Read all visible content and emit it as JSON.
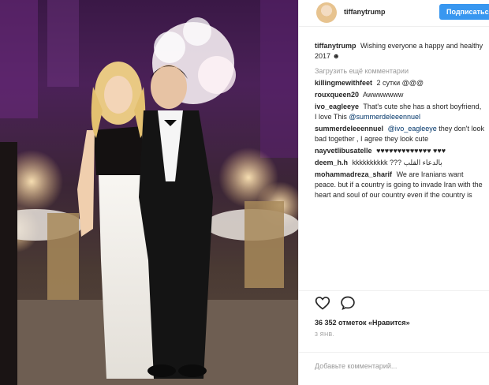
{
  "post": {
    "username": "tiffanytrump",
    "follow_label": "Подписаться",
    "caption_user": "tiffanytrump",
    "caption_text": "Wishing everyone a happy and healthy 2017 ☻",
    "likes": "36 352 отметок «Нравится»",
    "posted": "3 ЯНВ.",
    "add_comment_placeholder": "Добавьте комментарий..."
  },
  "comments": [
    {
      "user": "",
      "text": "Загрузить ещё комментарии"
    },
    {
      "user": "killingmewithfeet",
      "text": "2 сутки @@@"
    },
    {
      "user": "rouxqueen20",
      "text": "Awwwwwww"
    },
    {
      "user": "ivo_eagleeye",
      "text": "That's cute she has a short boyfriend, I love This",
      "mention": "@summerdeleeennuel"
    },
    {
      "user": "summerdeleeennuel",
      "text": "they don't look bad together , I agree they look cute",
      "mention": "@ivo_eagleeye"
    },
    {
      "user": "nayvetlibusatelle",
      "text": "♥♥♥♥♥♥♥♥♥♥♥♥♥ ♥♥♥"
    },
    {
      "user": "deem_h.h",
      "text": "kkkkkkkkkk ??? بالدعاء القلب"
    },
    {
      "user": "mohammadreza_sharif",
      "text": "We are Iranians want peace. but if a country is going to invade Iran with the heart and soul of our country even if the country is America. You will never see us"
    }
  ],
  "icons": {
    "like": "heart-outline-icon",
    "comment": "comment-bubble-icon",
    "save": "bookmark-icon"
  },
  "colors": {
    "accent": "#3897f0",
    "text": "#262626",
    "muted": "#999999"
  }
}
